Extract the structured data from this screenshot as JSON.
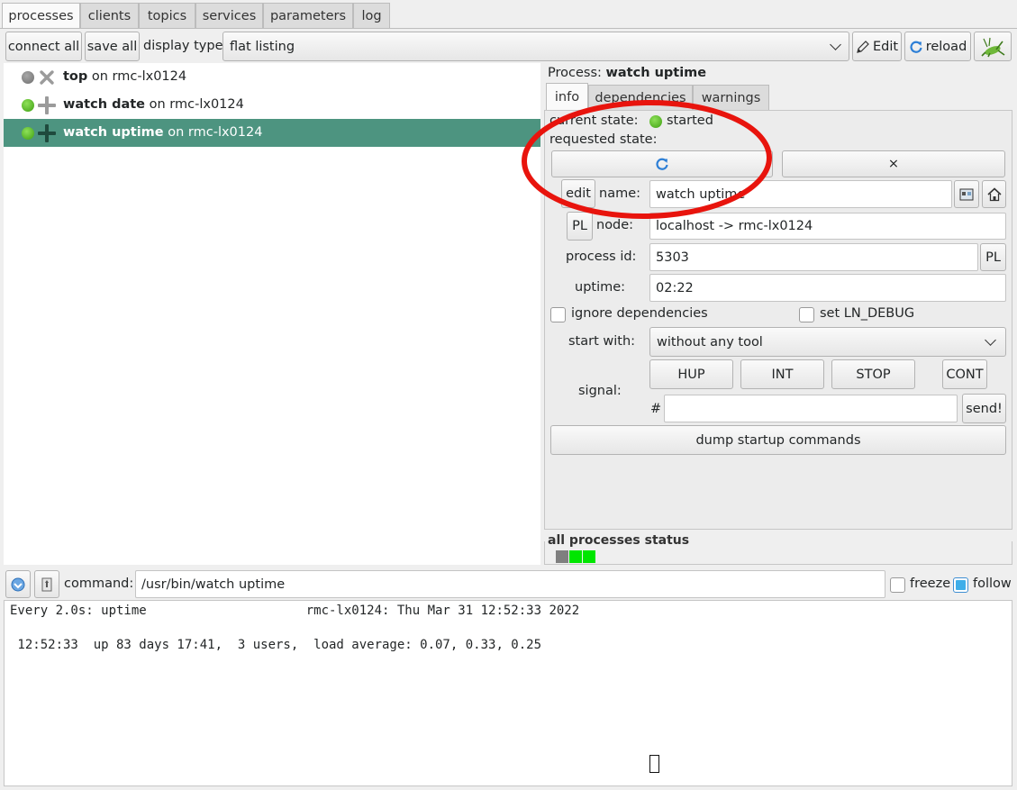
{
  "tabs": [
    {
      "label": "processes"
    },
    {
      "label": "clients"
    },
    {
      "label": "topics"
    },
    {
      "label": "services"
    },
    {
      "label": "parameters"
    },
    {
      "label": "log"
    }
  ],
  "toolbar": {
    "connect_all": "connect all",
    "save_all": "save all",
    "display_type_label": "display type:",
    "display_type_value": "flat listing",
    "edit_label": "Edit",
    "reload_label": "reload"
  },
  "processes": [
    {
      "name": "top",
      "host": "on rmc-lx0124",
      "status": "stopped"
    },
    {
      "name": "watch date",
      "host": "on rmc-lx0124",
      "status": "started"
    },
    {
      "name": "watch uptime",
      "host": "on rmc-lx0124",
      "status": "started",
      "selected": true
    }
  ],
  "detail": {
    "title_prefix": "Process:",
    "title_name": "watch uptime",
    "tabs": [
      "info",
      "dependencies",
      "warnings"
    ],
    "current_state_label": "current state:",
    "current_state_value": "started",
    "requested_state_label": "requested state:",
    "stop_symbol": "×",
    "edit_label": "edit",
    "name_label": "name:",
    "name_value": "watch uptime",
    "pl_label": "PL",
    "node_label": "node:",
    "node_value": "localhost -> rmc-lx0124",
    "pid_label": "process id:",
    "pid_value": "5303",
    "uptime_label": "uptime:",
    "uptime_value": "02:22",
    "ignore_deps_label": "ignore dependencies",
    "ln_debug_label": "set LN_DEBUG",
    "start_with_label": "start with:",
    "start_with_value": "without any tool",
    "signal_label": "signal:",
    "signals": [
      "HUP",
      "INT",
      "STOP",
      "CONT"
    ],
    "hash_label": "#",
    "send_label": "send!",
    "dump_label": "dump startup commands",
    "all_status_label": "all processes status"
  },
  "command": {
    "label": "command:",
    "value": "/usr/bin/watch uptime",
    "freeze_label": "freeze",
    "follow_label": "follow"
  },
  "output": {
    "line1": "Every 2.0s: uptime                     rmc-lx0124: Thu Mar 31 12:52:33 2022",
    "line2": " 12:52:33  up 83 days 17:41,  3 users,  load average: 0.07, 0.33, 0.25"
  },
  "colors": {
    "selection": "#4d9480",
    "started": "#4fb81f",
    "stopped": "#7f7f7f",
    "annotation": "#e8140d"
  }
}
